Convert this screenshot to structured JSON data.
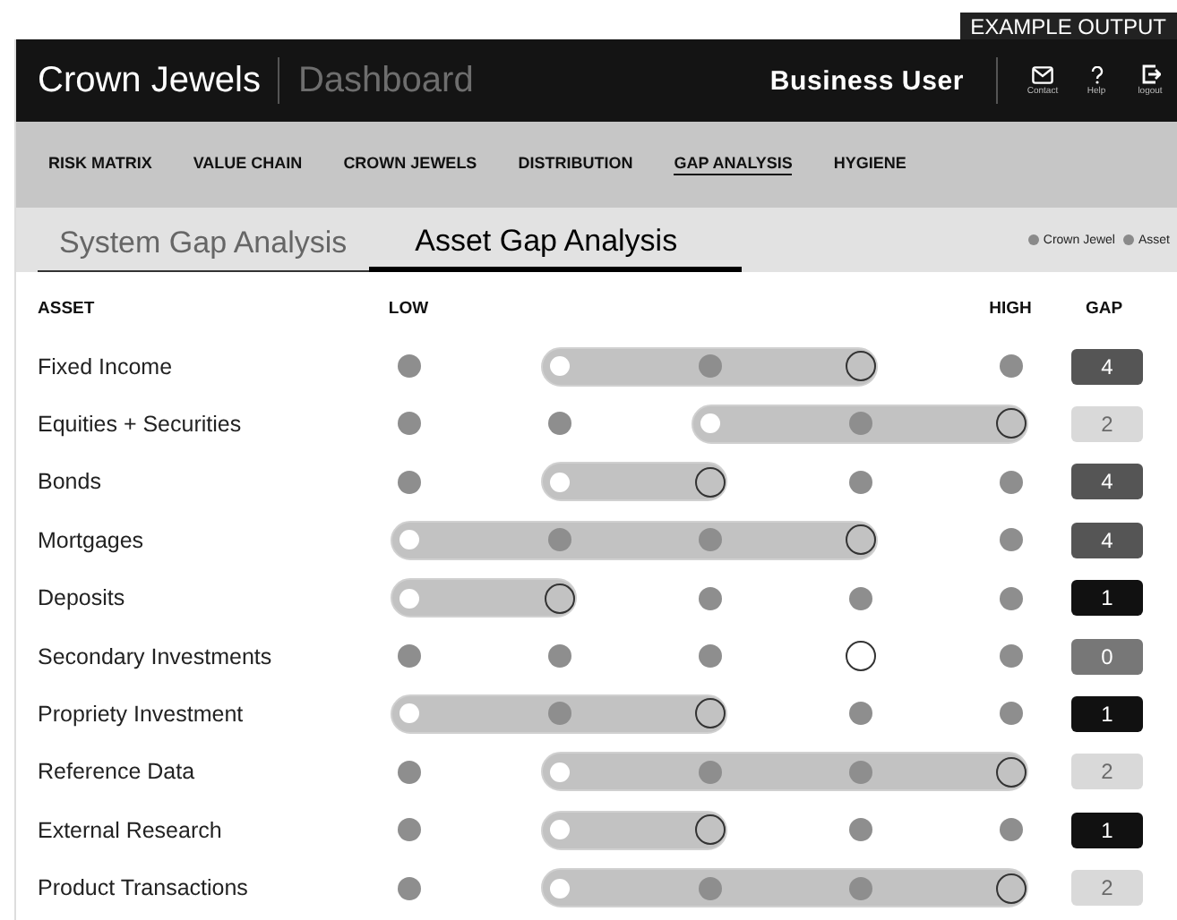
{
  "caption": "EXAMPLE OUTPUT",
  "header": {
    "title": "Crown Jewels",
    "subtitle": "Dashboard",
    "user": "Business User",
    "actions": [
      {
        "kind": "mail",
        "label": "Contact"
      },
      {
        "kind": "help",
        "label": "Help"
      },
      {
        "kind": "logout",
        "label": "logout"
      }
    ]
  },
  "nav": [
    {
      "label": "RISK MATRIX",
      "selected": false
    },
    {
      "label": "VALUE CHAIN",
      "selected": false
    },
    {
      "label": "CROWN JEWELS",
      "selected": false
    },
    {
      "label": "DISTRIBUTION",
      "selected": false
    },
    {
      "label": "GAP ANALYSIS",
      "selected": true
    },
    {
      "label": "HYGIENE",
      "selected": false
    }
  ],
  "tabs": [
    {
      "label": "System Gap Analysis",
      "selected": false
    },
    {
      "label": "Asset Gap Analysis",
      "selected": true
    }
  ],
  "legend": [
    {
      "label": "Crown Jewel",
      "color": "#8a8a8a"
    },
    {
      "label": "Asset",
      "color": "#8a8a8a"
    }
  ],
  "table": {
    "columns": {
      "asset": "ASSET",
      "low": "LOW",
      "high": "HIGH",
      "gap": "GAP"
    },
    "rows": [
      {
        "asset": "Fixed Income",
        "points": [
          {
            "kind": "dot"
          },
          {
            "kind": "start"
          },
          {
            "kind": "mid"
          },
          {
            "kind": "end"
          },
          {
            "kind": "dot"
          }
        ],
        "gap": "4",
        "color": "#555555"
      },
      {
        "asset": "Equities + Securities",
        "points": [
          {
            "kind": "dot"
          },
          {
            "kind": "dot"
          },
          {
            "kind": "start"
          },
          {
            "kind": "mid"
          },
          {
            "kind": "end"
          }
        ],
        "gap": "2",
        "color": "#d9d9d9"
      },
      {
        "asset": "Bonds",
        "points": [
          {
            "kind": "dot"
          },
          {
            "kind": "start"
          },
          {
            "kind": "end"
          },
          {
            "kind": "dot"
          },
          {
            "kind": "dot"
          }
        ],
        "gap": "4",
        "color": "#555555"
      },
      {
        "asset": "Mortgages",
        "points": [
          {
            "kind": "start"
          },
          {
            "kind": "mid"
          },
          {
            "kind": "mid"
          },
          {
            "kind": "end"
          },
          {
            "kind": "dot"
          }
        ],
        "gap": "4",
        "color": "#555555"
      },
      {
        "asset": "Deposits",
        "points": [
          {
            "kind": "start"
          },
          {
            "kind": "end"
          },
          {
            "kind": "dot"
          },
          {
            "kind": "dot"
          },
          {
            "kind": "dot"
          }
        ],
        "gap": "1",
        "color": "#111111"
      },
      {
        "asset": "Secondary Investments",
        "points": [
          {
            "kind": "dot"
          },
          {
            "kind": "dot"
          },
          {
            "kind": "dot"
          },
          {
            "kind": "ring"
          },
          {
            "kind": "dot"
          }
        ],
        "gap": "0",
        "color": "#777777"
      },
      {
        "asset": "Propriety Investment",
        "points": [
          {
            "kind": "start"
          },
          {
            "kind": "mid"
          },
          {
            "kind": "end"
          },
          {
            "kind": "dot"
          },
          {
            "kind": "dot"
          }
        ],
        "gap": "1",
        "color": "#111111"
      },
      {
        "asset": "Reference Data",
        "points": [
          {
            "kind": "dot"
          },
          {
            "kind": "start"
          },
          {
            "kind": "mid"
          },
          {
            "kind": "mid"
          },
          {
            "kind": "end"
          }
        ],
        "gap": "2",
        "color": "#d9d9d9"
      },
      {
        "asset": "External Research",
        "points": [
          {
            "kind": "dot"
          },
          {
            "kind": "start"
          },
          {
            "kind": "end"
          },
          {
            "kind": "dot"
          },
          {
            "kind": "dot"
          }
        ],
        "gap": "1",
        "color": "#111111"
      },
      {
        "asset": "Product Transactions",
        "points": [
          {
            "kind": "dot"
          },
          {
            "kind": "start"
          },
          {
            "kind": "mid"
          },
          {
            "kind": "mid"
          },
          {
            "kind": "end"
          }
        ],
        "gap": "2",
        "color": "#d9d9d9"
      }
    ]
  }
}
